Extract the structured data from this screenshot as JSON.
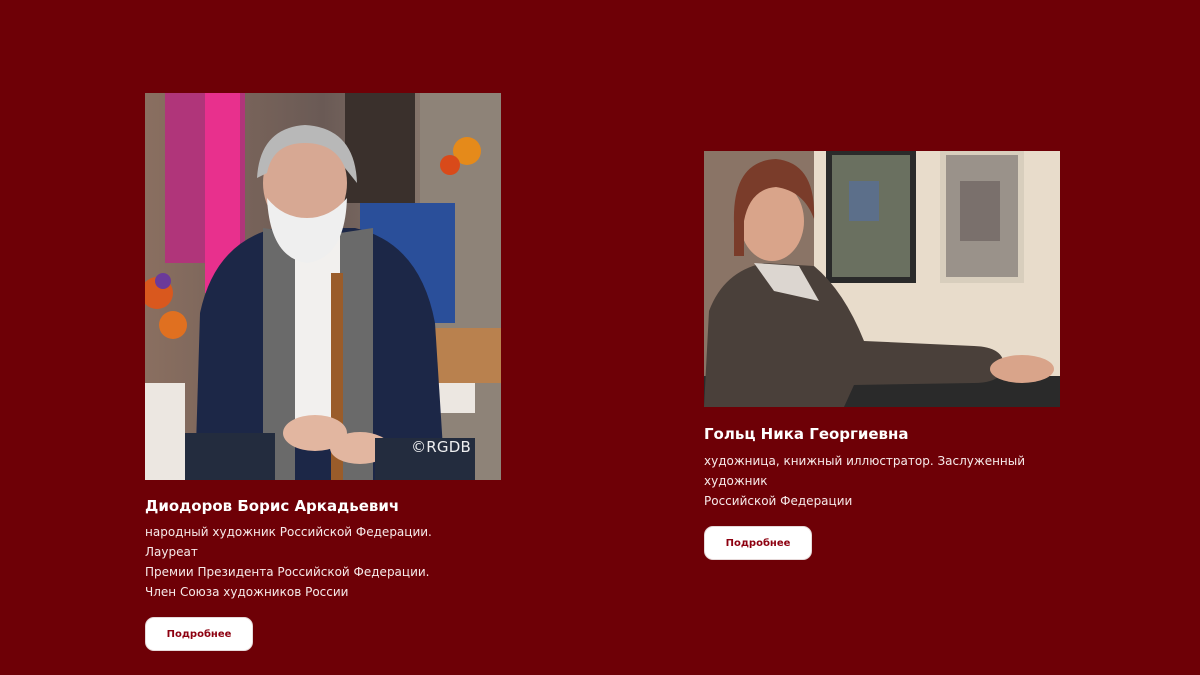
{
  "artists": [
    {
      "name": "Диодоров Борис Аркадьевич",
      "description_lines": [
        "народный художник Российской Федерации. Лауреат",
        "Премии Президента Российской Федерации.",
        "Член Союза художников России"
      ],
      "photo_watermark": "©RGDB",
      "more_label": "Подробнее"
    },
    {
      "name": "Гольц Ника Георгиевна",
      "description_lines": [
        "художница, книжный иллюстратор. Заслуженный художник",
        "Российской Федерации"
      ],
      "more_label": "Подробнее"
    }
  ],
  "colors": {
    "background": "#6e0006",
    "button_bg": "#ffffff",
    "button_text": "#8d0010"
  }
}
